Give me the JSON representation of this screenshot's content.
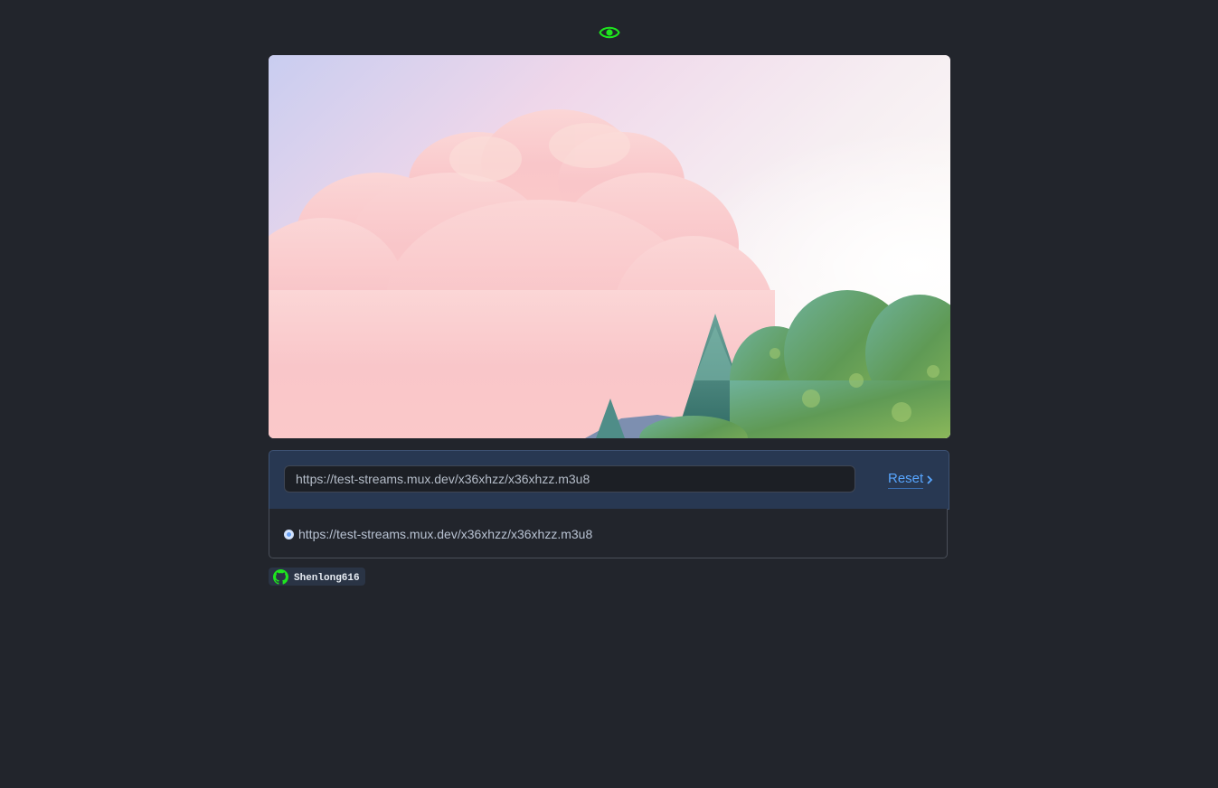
{
  "player": {
    "stream_url_value": "https://test-streams.mux.dev/x36xhzz/x36xhzz.m3u8",
    "reset_label": "Reset"
  },
  "history": {
    "items": [
      {
        "label": "https://test-streams.mux.dev/x36xhzz/x36xhzz.m3u8",
        "selected": true
      }
    ]
  },
  "footer": {
    "github_user": "Shenlong616"
  },
  "icons": {
    "logo": "eye-icon",
    "reset": "chevron-right-icon",
    "radio": "radio-selected-icon",
    "github": "github-icon"
  },
  "colors": {
    "background": "#22252c",
    "accent_green": "#1ee51e",
    "link_blue": "#58a6ff",
    "panel_blue": "#283852"
  }
}
